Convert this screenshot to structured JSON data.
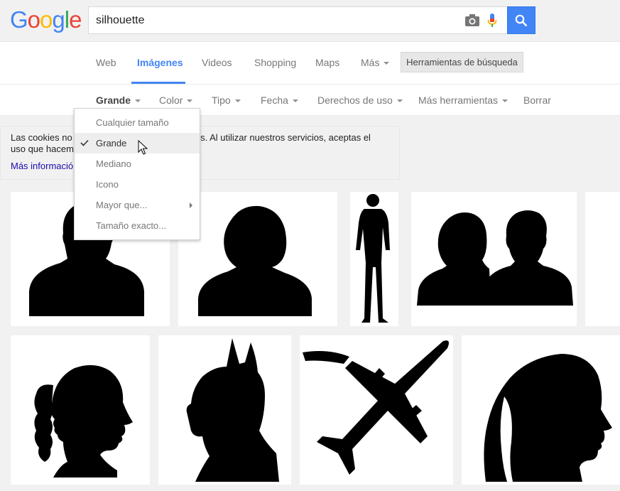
{
  "header": {
    "logo_letters": [
      {
        "ch": "G",
        "color": "#4285f4"
      },
      {
        "ch": "o",
        "color": "#ea4335"
      },
      {
        "ch": "o",
        "color": "#fbbc05"
      },
      {
        "ch": "g",
        "color": "#4285f4"
      },
      {
        "ch": "l",
        "color": "#34a853"
      },
      {
        "ch": "e",
        "color": "#ea4335"
      }
    ],
    "search_value": "silhouette",
    "icons": [
      "camera-icon",
      "microphone-icon",
      "search-icon"
    ]
  },
  "tabs": {
    "items": [
      "Web",
      "Imágenes",
      "Videos",
      "Shopping",
      "Maps",
      "Más"
    ],
    "active": "Imágenes",
    "tools_label": "Herramientas de búsqueda"
  },
  "filters": {
    "items": [
      "Grande",
      "Color",
      "Tipo",
      "Fecha",
      "Derechos de uso",
      "Más herramientas",
      "Borrar"
    ],
    "active": "Grande"
  },
  "cookie": {
    "line1": "Las cookies no",
    "line1b": "rvicios. Al utilizar nuestros servicios, aceptas el",
    "line2": "uso que hacem",
    "more": "Más informació"
  },
  "size_menu": {
    "items": [
      "Cualquier tamaño",
      "Grande",
      "Mediano",
      "Icono",
      "Mayor que...",
      "Tamaño exacto..."
    ],
    "selected": "Grande"
  },
  "colors": {
    "accent": "#4285f4",
    "link": "#1a0dab"
  }
}
